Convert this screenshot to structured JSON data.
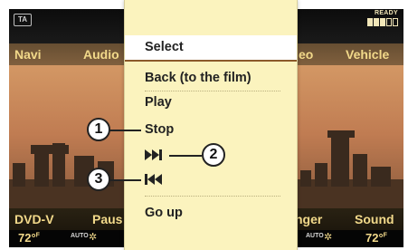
{
  "status": {
    "ta_badge": "TA",
    "ready_label": "READY"
  },
  "top_menu": [
    "Navi",
    "Audio",
    "eo",
    "Vehicle"
  ],
  "bottom_menu": [
    "DVD-V",
    "Paus",
    "nger",
    "Sound"
  ],
  "climate": {
    "left_temp": "72°",
    "left_unit": "F",
    "left_auto": "AUTO",
    "right_auto": "AUTO",
    "right_temp": "72°",
    "right_unit": "F"
  },
  "popup_menu": {
    "items": [
      {
        "label": "Select",
        "selected": true
      },
      {
        "label": "Back (to the film)"
      },
      {
        "label": "Play"
      },
      {
        "label": "Stop"
      },
      {
        "icon": "skip-forward-icon"
      },
      {
        "icon": "skip-back-icon"
      },
      {
        "label": "Go up"
      }
    ]
  },
  "callouts": [
    "1",
    "2",
    "3"
  ],
  "colors": {
    "menu_text": "#f2d98a",
    "popup_bg": "#fbf3be",
    "selection_underline": "#8b5a2a"
  }
}
